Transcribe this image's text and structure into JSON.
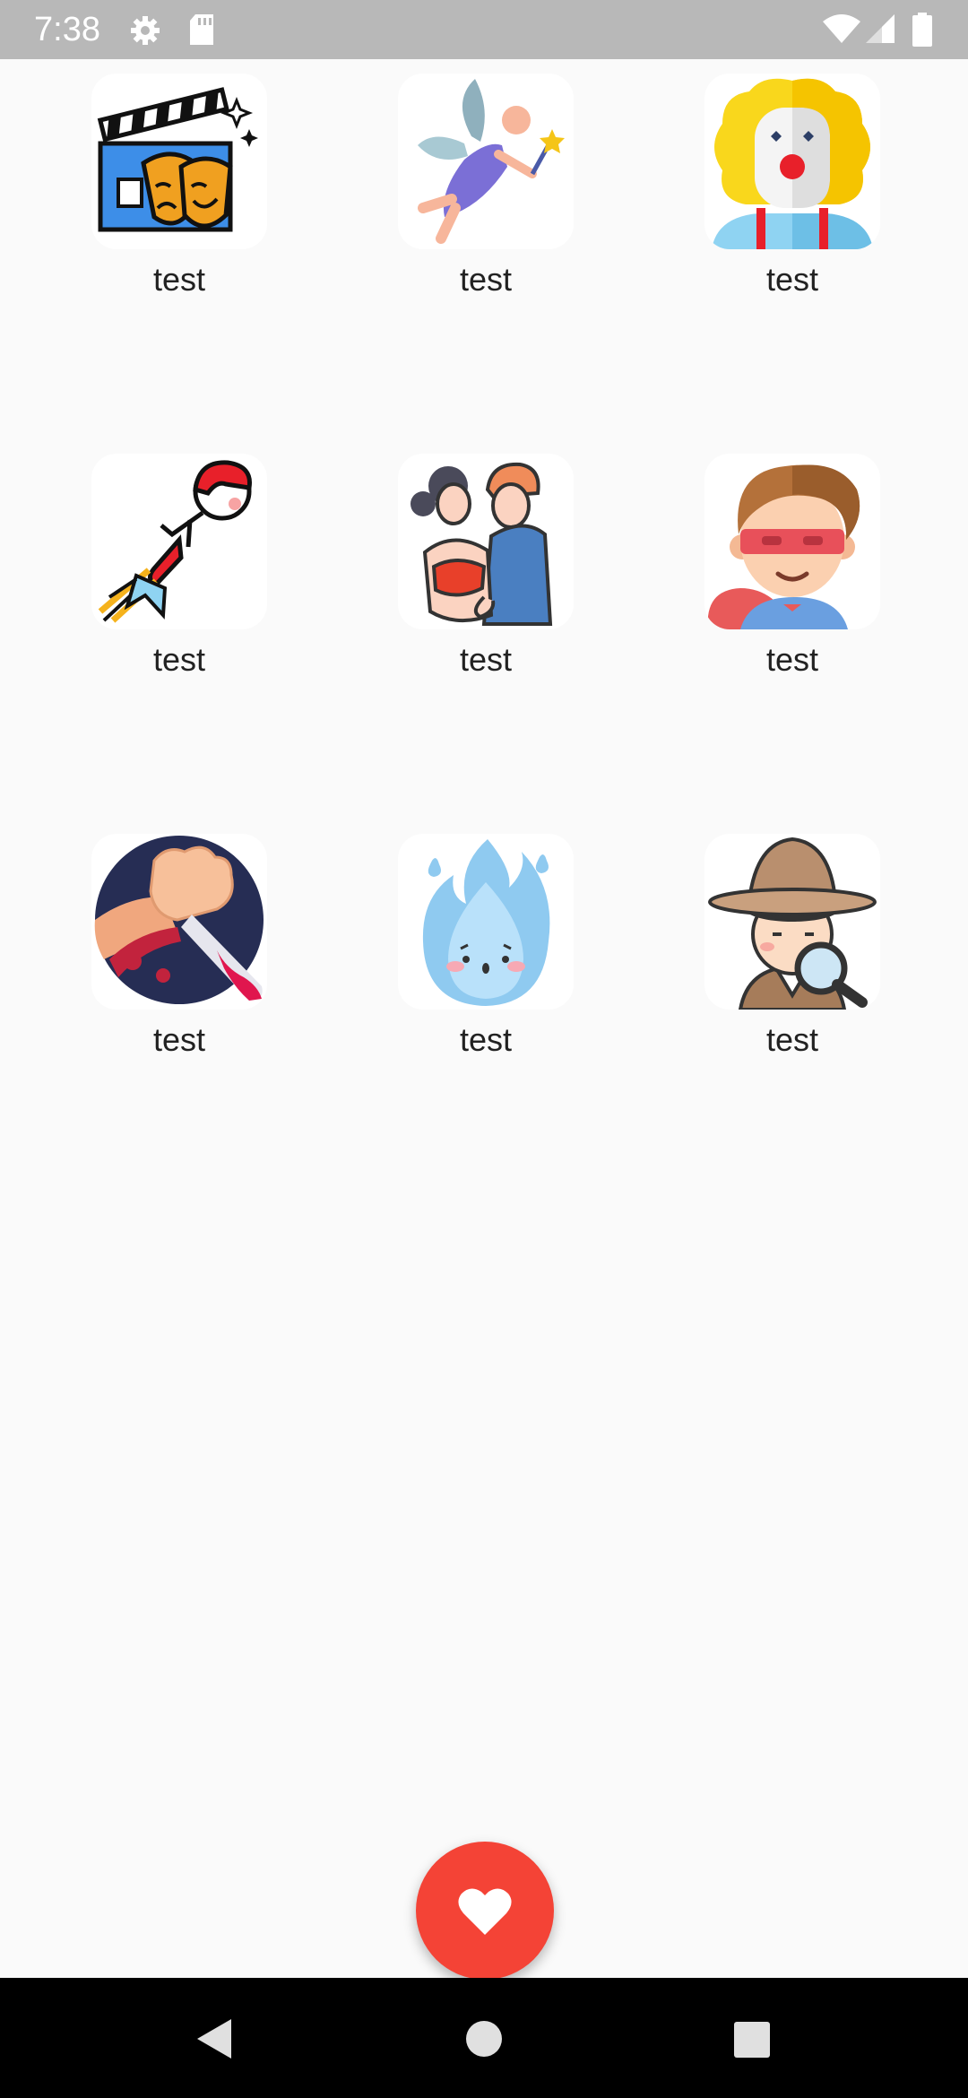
{
  "status_bar": {
    "time": "7:38",
    "icons": [
      "gear-icon",
      "sd-card-icon",
      "wifi-icon",
      "signal-icon",
      "battery-icon"
    ]
  },
  "grid": {
    "items": [
      {
        "label": "test",
        "icon": "theater-clapperboard-masks"
      },
      {
        "label": "test",
        "icon": "fairy-with-wand"
      },
      {
        "label": "test",
        "icon": "clown"
      },
      {
        "label": "test",
        "icon": "rocket-hero"
      },
      {
        "label": "test",
        "icon": "romantic-couple"
      },
      {
        "label": "test",
        "icon": "masked-superhero-kid"
      },
      {
        "label": "test",
        "icon": "hand-with-knife"
      },
      {
        "label": "test",
        "icon": "blue-flame"
      },
      {
        "label": "test",
        "icon": "detective-magnifier"
      }
    ]
  },
  "fab": {
    "icon": "heart-icon",
    "color": "#f44336"
  },
  "nav_bar": {
    "buttons": [
      "back-icon",
      "home-icon",
      "recents-icon"
    ]
  }
}
